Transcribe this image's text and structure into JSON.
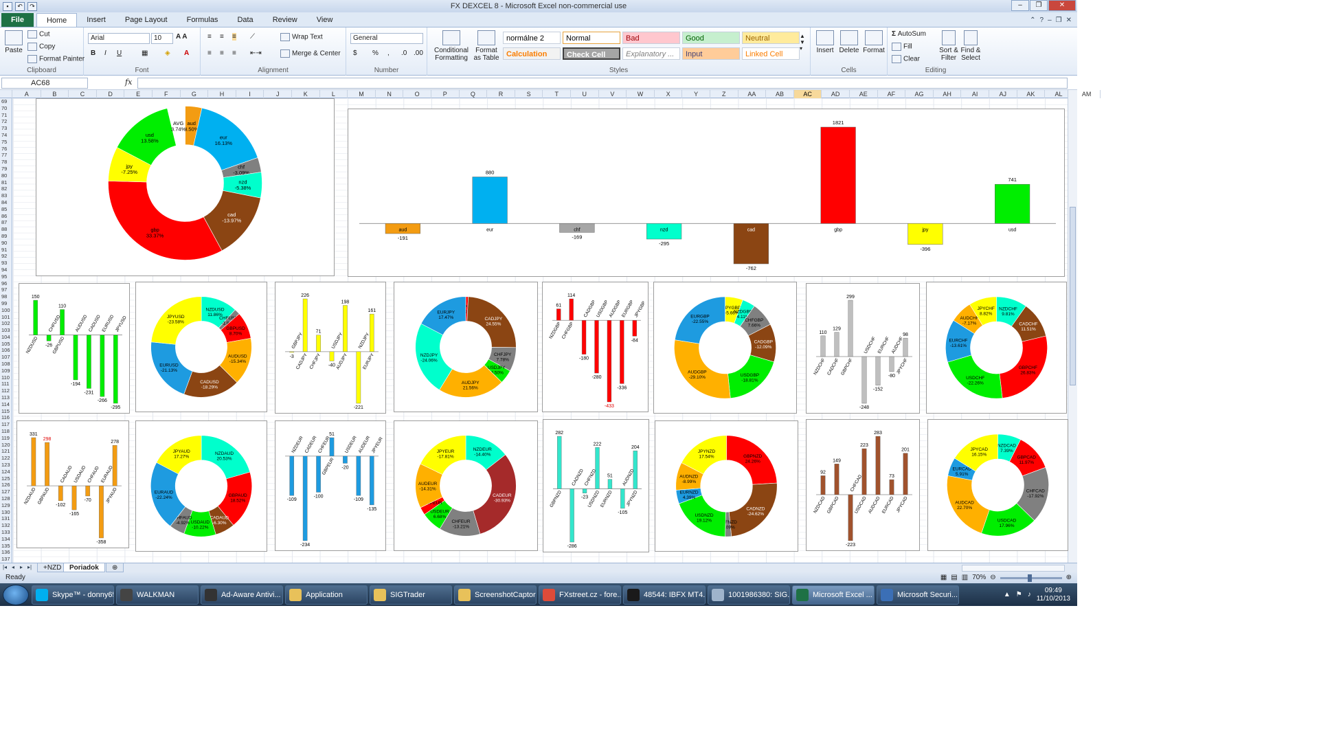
{
  "window": {
    "title": "FX DEXCEL 8  -  Microsoft Excel non-commercial use"
  },
  "tabs": [
    "File",
    "Home",
    "Insert",
    "Page Layout",
    "Formulas",
    "Data",
    "Review",
    "View"
  ],
  "clipboard": {
    "paste": "Paste",
    "cut": "Cut",
    "copy": "Copy",
    "format_painter": "Format Painter",
    "label": "Clipboard"
  },
  "font": {
    "name": "Arial",
    "size": "10",
    "label": "Font"
  },
  "alignment": {
    "wrap": "Wrap Text",
    "merge": "Merge & Center",
    "label": "Alignment"
  },
  "number": {
    "format": "General",
    "label": "Number"
  },
  "styles_grp": {
    "cond": "Conditional Formatting",
    "fmt_table": "Format as Table",
    "label": "Styles",
    "cells": [
      {
        "text": "normálne 2",
        "bg": "#ffffff",
        "color": "#000000"
      },
      {
        "text": "Normal",
        "bg": "#ffffff",
        "color": "#000000"
      },
      {
        "text": "Bad",
        "bg": "#ffc7ce",
        "color": "#9c0006"
      },
      {
        "text": "Good",
        "bg": "#c6efce",
        "color": "#006100"
      },
      {
        "text": "Neutral",
        "bg": "#ffeb9c",
        "color": "#9c6500"
      },
      {
        "text": "Calculation",
        "bg": "#f2f2f2",
        "color": "#fa7d00"
      },
      {
        "text": "Check Cell",
        "bg": "#a5a5a5",
        "color": "#ffffff"
      },
      {
        "text": "Explanatory ...",
        "bg": "#ffffff",
        "color": "#7f7f7f"
      },
      {
        "text": "Input",
        "bg": "#ffcc99",
        "color": "#3f3f76"
      },
      {
        "text": "Linked Cell",
        "bg": "#ffffff",
        "color": "#fa7d00"
      }
    ]
  },
  "cells_grp": {
    "insert": "Insert",
    "delete": "Delete",
    "format": "Format",
    "label": "Cells"
  },
  "editing": {
    "autosum": "AutoSum",
    "fill": "Fill",
    "clear": "Clear",
    "sort": "Sort & Filter",
    "find": "Find & Select",
    "label": "Editing"
  },
  "formula_bar": {
    "name_box": "AC68",
    "fx": "fx",
    "value": ""
  },
  "columns": [
    "A",
    "B",
    "C",
    "D",
    "E",
    "F",
    "G",
    "H",
    "I",
    "J",
    "K",
    "L",
    "M",
    "N",
    "O",
    "P",
    "Q",
    "R",
    "S",
    "T",
    "U",
    "V",
    "W",
    "X",
    "Y",
    "Z",
    "AA",
    "AB",
    "AC",
    "AD",
    "AE",
    "AF",
    "AG",
    "AH",
    "AI",
    "AJ",
    "AK",
    "AL",
    "AM"
  ],
  "selected_column": "AC",
  "rows": [
    "69",
    "70",
    "71",
    "72",
    "73",
    "74",
    "75",
    "76",
    "77",
    "78",
    "79",
    "80",
    "81",
    "82",
    "83",
    "84",
    "85",
    "86",
    "87",
    "88",
    "89",
    "90",
    "91",
    "92",
    "93",
    "94",
    "95",
    "96",
    "97",
    "98",
    "99",
    "100",
    "101",
    "102",
    "103",
    "104",
    "105",
    "106",
    "107",
    "108",
    "109",
    "110",
    "111",
    "112",
    "113",
    "114",
    "115",
    "116",
    "117",
    "118",
    "119",
    "120",
    "121",
    "122",
    "123",
    "124",
    "125",
    "126",
    "127",
    "128",
    "129",
    "130",
    "131",
    "132",
    "133",
    "134",
    "135",
    "136",
    "137"
  ],
  "sheets": [
    {
      "name": "+NZD",
      "active": false
    },
    {
      "name": "Poriadok",
      "active": true
    }
  ],
  "status": {
    "ready": "Ready",
    "zoom": "70%"
  },
  "taskbar": {
    "items": [
      {
        "label": "Skype™ - donny65",
        "color": "#00aff0"
      },
      {
        "label": "WALKMAN",
        "color": "#444444"
      },
      {
        "label": "Ad-Aware Antivi...",
        "color": "#333333"
      },
      {
        "label": "Application",
        "color": "#e8c15a"
      },
      {
        "label": "SIGTrader",
        "color": "#e8c15a"
      },
      {
        "label": "ScreenshotCaptor",
        "color": "#e8c15a"
      },
      {
        "label": "FXstreet.cz - fore...",
        "color": "#dd4b39"
      },
      {
        "label": "48544: IBFX MT4...",
        "color": "#1a1a1a"
      },
      {
        "label": "1001986380: SIG...",
        "color": "#9fb4cc"
      },
      {
        "label": "Microsoft Excel ...",
        "color": "#1e7145"
      },
      {
        "label": "Microsoft Securi...",
        "color": "#3b6fb6"
      }
    ],
    "time": "09:49",
    "date": "11/10/2013"
  },
  "chart_data": [
    {
      "type": "pie",
      "donut": true,
      "slices": [
        {
          "label": "aud",
          "pct": "3.50%",
          "value": 3.5,
          "color": "#f39c12"
        },
        {
          "label": "eur",
          "pct": "16.13%",
          "value": 16.13,
          "color": "#00b0f0"
        },
        {
          "label": "chf",
          "pct": "-3.09%",
          "value": 3.09,
          "color": "#808080"
        },
        {
          "label": "nzd",
          "pct": "-5.38%",
          "value": 5.38,
          "color": "#00ffcc"
        },
        {
          "label": "cad",
          "pct": "-13.97%",
          "value": 13.97,
          "color": "#8b4513"
        },
        {
          "label": "gbp",
          "pct": "33.37%",
          "value": 33.37,
          "color": "#ff0000"
        },
        {
          "label": "jpy",
          "pct": "-7.25%",
          "value": 7.25,
          "color": "#ffff00"
        },
        {
          "label": "usd",
          "pct": "13.58%",
          "value": 13.58,
          "color": "#00ee00"
        },
        {
          "label": "AVG",
          "pct": "3.74%",
          "value": 3.74,
          "color": "#ffffff"
        }
      ]
    },
    {
      "type": "bar",
      "labels": [
        {
          "cat": "aud",
          "value": -191,
          "color": "#f39c12"
        },
        {
          "cat": "eur",
          "value": 880,
          "color": "#00b0f0"
        },
        {
          "cat": "chf",
          "value": -169,
          "color": "#a6a6a6"
        },
        {
          "cat": "nzd",
          "value": -295,
          "color": "#00ffcc"
        },
        {
          "cat": "cad",
          "value": -762,
          "color": "#8b4513"
        },
        {
          "cat": "gbp",
          "value": 1821,
          "color": "#ff0000"
        },
        {
          "cat": "jpy",
          "value": -396,
          "color": "#ffff00"
        },
        {
          "cat": "usd",
          "value": 741,
          "color": "#00ee00"
        }
      ]
    },
    {
      "type": "bar",
      "color": "#00ee00",
      "categories": [
        "NZDUSD",
        "CHFUSD",
        "GBPUSD",
        "AUDUSD",
        "CADUSD",
        "EURUSD",
        "JPYUSD"
      ],
      "values": [
        150,
        -26,
        110,
        -194,
        -231,
        -266,
        -295
      ]
    },
    {
      "type": "pie",
      "donut": true,
      "slices": [
        {
          "label": "NZDUSD",
          "pct": "11.86%",
          "value": 11.86,
          "color": "#00ffcc"
        },
        {
          "label": "CHFUSD",
          "pct": "-1.83%",
          "value": 1.83,
          "color": "#808080"
        },
        {
          "label": "GBPUSD",
          "pct": "8.70%",
          "value": 8.7,
          "color": "#ff0000"
        },
        {
          "label": "AUDUSD",
          "pct": "-15.34%",
          "value": 15.34,
          "color": "#ffb000"
        },
        {
          "label": "CADUSD",
          "pct": "-18.29%",
          "value": 18.29,
          "color": "#8b4513"
        },
        {
          "label": "EURUSD",
          "pct": "-21.13%",
          "value": 21.13,
          "color": "#1e9be0"
        },
        {
          "label": "JPYUSD",
          "pct": "-23.58%",
          "value": 23.58,
          "color": "#ffff00"
        }
      ]
    },
    {
      "type": "bar",
      "color": "#ffff00",
      "categories": [
        "GBPJPY",
        "CADJPY",
        "CHFJPY",
        "USDJPY",
        "AUDJPY",
        "NZDJPY",
        "EURJPY"
      ],
      "values": [
        -3,
        226,
        71,
        -40,
        198,
        -221,
        161
      ]
    },
    {
      "type": "pie",
      "donut": true,
      "slices": [
        {
          "label": "GBPJPY",
          "pct": "-0.27%",
          "value": 0.8,
          "color": "#ff0000"
        },
        {
          "label": "CADJPY",
          "pct": "24.55%",
          "value": 24.55,
          "color": "#8b4513"
        },
        {
          "label": "CHFJPY",
          "pct": "7.78%",
          "value": 7.78,
          "color": "#808080"
        },
        {
          "label": "USDJPY",
          "pct": "-4.50%",
          "value": 4.5,
          "color": "#00ee00"
        },
        {
          "label": "AUDJPY",
          "pct": "21.56%",
          "value": 21.56,
          "color": "#ffb000"
        },
        {
          "label": "NZDJPY",
          "pct": "-24.06%",
          "value": 24.06,
          "color": "#00ffcc"
        },
        {
          "label": "EURJPY",
          "pct": "17.47%",
          "value": 17.47,
          "color": "#1e9be0"
        }
      ]
    },
    {
      "type": "bar",
      "color": "#ff0000",
      "categories": [
        "NZDGBP",
        "CHFGBP",
        "CADGBP",
        "USDGBP",
        "AUDGBP",
        "EURGBP",
        "JPYGBP"
      ],
      "values": [
        61,
        114,
        -180,
        -280,
        -433,
        -336,
        -84
      ],
      "highlight": -433
    },
    {
      "type": "pie",
      "donut": true,
      "slices": [
        {
          "label": "JPYGBP",
          "pct": "-5.66%",
          "value": 5.66,
          "color": "#ffff00"
        },
        {
          "label": "NZDGBP",
          "pct": "4.11%",
          "value": 4.11,
          "color": "#00ffcc"
        },
        {
          "label": "CHFGBP",
          "pct": "7.66%",
          "value": 7.66,
          "color": "#808080"
        },
        {
          "label": "CADGBP",
          "pct": "-12.09%",
          "value": 12.09,
          "color": "#8b4513"
        },
        {
          "label": "USDGBP",
          "pct": "-18.81%",
          "value": 18.81,
          "color": "#00ee00"
        },
        {
          "label": "AUDGBP",
          "pct": "-29.10%",
          "value": 29.1,
          "color": "#ffb000"
        },
        {
          "label": "EURGBP",
          "pct": "-22.55%",
          "value": 22.55,
          "color": "#1e9be0"
        }
      ]
    },
    {
      "type": "bar",
      "color": "#bfbfbf",
      "categories": [
        "NZDCHF",
        "CADCHF",
        "GBPCHF",
        "USDCHF",
        "EURCHF",
        "AUDCHF",
        "JPYCHF"
      ],
      "values": [
        110,
        129,
        299,
        -248,
        -152,
        -80,
        98
      ]
    },
    {
      "type": "pie",
      "donut": true,
      "slices": [
        {
          "label": "NZDCHF",
          "pct": "9.81%",
          "value": 9.81,
          "color": "#00ffcc"
        },
        {
          "label": "CADCHF",
          "pct": "11.51%",
          "value": 11.51,
          "color": "#8b4513"
        },
        {
          "label": "GBPCHF",
          "pct": "26.83%",
          "value": 26.83,
          "color": "#ff0000"
        },
        {
          "label": "USDCHF",
          "pct": "-22.26%",
          "value": 22.26,
          "color": "#00ee00"
        },
        {
          "label": "EURCHF",
          "pct": "-13.61%",
          "value": 13.61,
          "color": "#1e9be0"
        },
        {
          "label": "AUDCHF",
          "pct": "-7.17%",
          "value": 7.17,
          "color": "#ffb000"
        },
        {
          "label": "JPYCHF",
          "pct": "8.82%",
          "value": 8.82,
          "color": "#ffff00"
        }
      ]
    },
    {
      "type": "bar",
      "color": "#f39c12",
      "categories": [
        "NZDAUD",
        "GBPAUD",
        "CADAUD",
        "USDAUD",
        "CHFAUD",
        "EURAUD",
        "JPYAUD"
      ],
      "values": [
        331,
        298,
        -102,
        -165,
        -70,
        -358,
        278
      ],
      "highlight": 298
    },
    {
      "type": "pie",
      "donut": true,
      "slices": [
        {
          "label": "NZDAUD",
          "pct": "20.53%",
          "value": 20.53,
          "color": "#00ffcc"
        },
        {
          "label": "GBPAUD",
          "pct": "18.52%",
          "value": 18.52,
          "color": "#ff0000"
        },
        {
          "label": "CADAUD",
          "pct": "-6.30%",
          "value": 6.3,
          "color": "#8b4513"
        },
        {
          "label": "USDAUD",
          "pct": "-10.22%",
          "value": 10.22,
          "color": "#00ee00"
        },
        {
          "label": "CHFAUD",
          "pct": "-4.92%",
          "value": 4.92,
          "color": "#808080"
        },
        {
          "label": "EURAUD",
          "pct": "-22.24%",
          "value": 22.24,
          "color": "#1e9be0"
        },
        {
          "label": "JPYAUD",
          "pct": "17.27%",
          "value": 17.27,
          "color": "#ffff00"
        }
      ]
    },
    {
      "type": "bar",
      "color": "#1e9be0",
      "categories": [
        "NZDEUR",
        "CADEUR",
        "CHFEUR",
        "GBPEUR",
        "USDEUR",
        "AUDEUR",
        "JPYEUR"
      ],
      "values": [
        -109,
        -234,
        -100,
        51,
        -20,
        -109,
        -135
      ]
    },
    {
      "type": "pie",
      "donut": true,
      "slices": [
        {
          "label": "NZDEUR",
          "pct": "-14.40%",
          "value": 14.4,
          "color": "#00ffcc"
        },
        {
          "label": "CADEUR",
          "pct": "-30.93%",
          "value": 30.93,
          "color": "#a52a2a"
        },
        {
          "label": "CHFEUR",
          "pct": "-13.21%",
          "value": 13.21,
          "color": "#808080"
        },
        {
          "label": "USDEUR",
          "pct": "6.68%",
          "value": 6.68,
          "color": "#00ee00"
        },
        {
          "label": "GBPEUR",
          "pct": "",
          "value": 2.5,
          "color": "#ff0000"
        },
        {
          "label": "AUDEUR",
          "pct": "-14.31%",
          "value": 14.31,
          "color": "#ffb000"
        },
        {
          "label": "JPYEUR",
          "pct": "-17.81%",
          "value": 17.81,
          "color": "#ffff00"
        }
      ]
    },
    {
      "type": "bar",
      "color": "#33e6cc",
      "categories": [
        "GBPNZD",
        "CADNZD",
        "CHFNZD",
        "USDNZD",
        "EURNZD",
        "AUDNZD",
        "JPYNZD"
      ],
      "values": [
        282,
        -286,
        -23,
        222,
        51,
        -105,
        204
      ]
    },
    {
      "type": "pie",
      "donut": true,
      "slices": [
        {
          "label": "GBPNZD",
          "pct": "24.26%",
          "value": 24.26,
          "color": "#ff0000"
        },
        {
          "label": "CADNZD",
          "pct": "-24.62%",
          "value": 24.62,
          "color": "#8b4513"
        },
        {
          "label": "CHFNZD",
          "pct": "-1.09%",
          "value": 2.0,
          "color": "#808080"
        },
        {
          "label": "USDNZD",
          "pct": "19.12%",
          "value": 19.12,
          "color": "#00ee00"
        },
        {
          "label": "EURNZD",
          "pct": "4.39%",
          "value": 4.39,
          "color": "#1e9be0"
        },
        {
          "label": "AUDNZD",
          "pct": "-8.99%",
          "value": 8.99,
          "color": "#ffb000"
        },
        {
          "label": "JPYNZD",
          "pct": "17.54%",
          "value": 17.54,
          "color": "#ffff00"
        }
      ]
    },
    {
      "type": "bar",
      "color": "#a0522d",
      "categories": [
        "NZDCAD",
        "GBPCAD",
        "CHFCAD",
        "USDCAD",
        "AUDCAD",
        "EURCAD",
        "JPYCAD"
      ],
      "values": [
        92,
        149,
        -223,
        223,
        283,
        73,
        201
      ]
    },
    {
      "type": "pie",
      "donut": true,
      "slices": [
        {
          "label": "NZDCAD",
          "pct": "7.39%",
          "value": 7.39,
          "color": "#00ffcc"
        },
        {
          "label": "GBPCAD",
          "pct": "11.97%",
          "value": 11.97,
          "color": "#ff0000"
        },
        {
          "label": "CHFCAD",
          "pct": "-17.92%",
          "value": 17.92,
          "color": "#808080"
        },
        {
          "label": "USDCAD",
          "pct": "17.96%",
          "value": 17.96,
          "color": "#00ee00"
        },
        {
          "label": "AUDCAD",
          "pct": "22.70%",
          "value": 22.7,
          "color": "#ffb000"
        },
        {
          "label": "EURCAD",
          "pct": "5.91%",
          "value": 5.91,
          "color": "#1e9be0"
        },
        {
          "label": "JPYCAD",
          "pct": "16.15%",
          "value": 16.15,
          "color": "#ffff00"
        }
      ]
    }
  ]
}
